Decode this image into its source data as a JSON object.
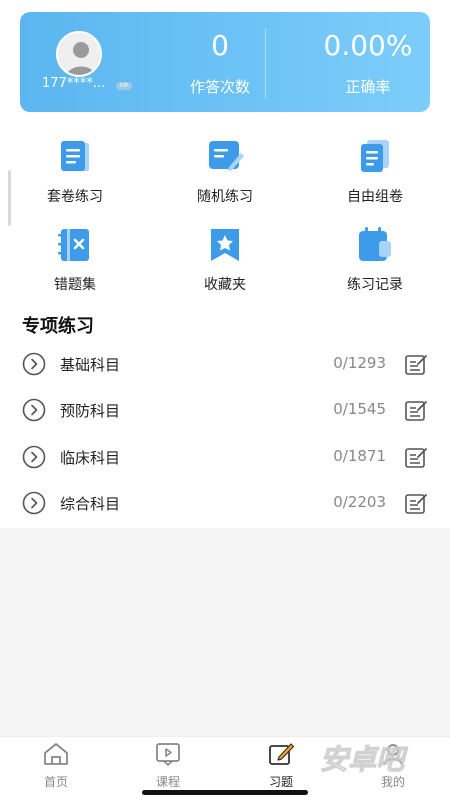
{
  "profile": {
    "phone": "177****...",
    "vip_badge": "VIP",
    "stats": [
      {
        "value": "0",
        "label": "作答次数"
      },
      {
        "value": "0.00%",
        "label": "正确率"
      }
    ]
  },
  "grid": [
    {
      "label": "套卷练习",
      "icon": "paper-scroll-icon"
    },
    {
      "label": "随机练习",
      "icon": "random-edit-icon"
    },
    {
      "label": "自由组卷",
      "icon": "stacked-paper-icon"
    },
    {
      "label": "错题集",
      "icon": "wrong-notebook-icon"
    },
    {
      "label": "收藏夹",
      "icon": "star-bookmark-icon"
    },
    {
      "label": "练习记录",
      "icon": "calendar-record-icon"
    }
  ],
  "section_title": "专项练习",
  "subjects": [
    {
      "name": "基础科目",
      "count": "0/1293"
    },
    {
      "name": "预防科目",
      "count": "0/1545"
    },
    {
      "name": "临床科目",
      "count": "0/1871"
    },
    {
      "name": "综合科目",
      "count": "0/2203"
    }
  ],
  "tabs": [
    {
      "label": "首页",
      "icon": "home-icon",
      "active": false
    },
    {
      "label": "课程",
      "icon": "video-book-icon",
      "active": false
    },
    {
      "label": "习题",
      "icon": "pen-edit-icon",
      "active": true
    },
    {
      "label": "我的",
      "icon": "user-icon",
      "active": false
    }
  ],
  "watermark_text": "安卓吧",
  "colors": {
    "banner_start": "#5bb6ef",
    "banner_end": "#7ccdfb",
    "icon_blue": "#3d9be9",
    "active_tab_accent": "#f5a623"
  }
}
